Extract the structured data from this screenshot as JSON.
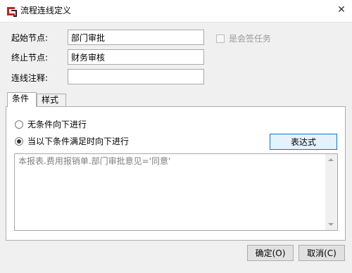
{
  "window": {
    "title": "流程连线定义",
    "close_symbol": "✕"
  },
  "form": {
    "start_label": "起始节点:",
    "start_value": "部门审批",
    "end_label": "终止节点:",
    "end_value": "财务审核",
    "comment_label": "连线注释:",
    "comment_value": "",
    "countersign_label": "是会签任务"
  },
  "tabs": [
    {
      "label": "条件"
    },
    {
      "label": "样式"
    }
  ],
  "condition": {
    "option_none": "无条件向下进行",
    "option_cond": "当以下条件满足时向下进行",
    "expression_button": "表达式",
    "expression_text": "本报表.费用报销单.部门审批意见='同意'"
  },
  "buttons": {
    "ok": "确定(O)",
    "cancel": "取消(C)"
  }
}
